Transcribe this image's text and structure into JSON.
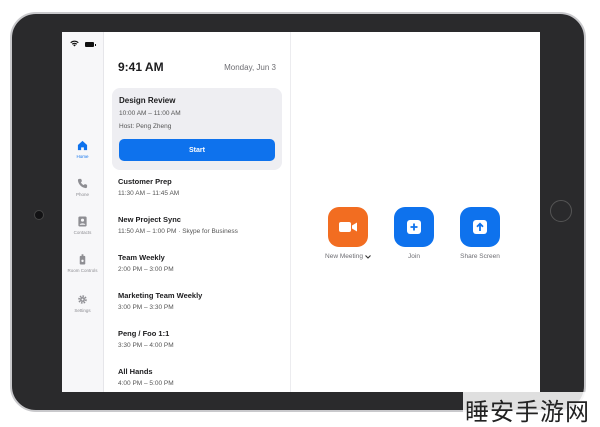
{
  "status_bar": {
    "wifi_icon": "wifi-icon",
    "battery_icon": "battery-icon"
  },
  "nav": {
    "items": [
      {
        "label": "Home",
        "icon": "home-icon",
        "active": true
      },
      {
        "label": "Phone",
        "icon": "phone-icon",
        "active": false
      },
      {
        "label": "Contacts",
        "icon": "contacts-icon",
        "active": false
      },
      {
        "label": "Room Controls",
        "icon": "room-controls-icon",
        "active": false
      },
      {
        "label": "Settings",
        "icon": "gear-icon",
        "active": false
      }
    ]
  },
  "header": {
    "time": "9:41 AM",
    "date": "Monday, Jun 3"
  },
  "current_meeting": {
    "title": "Design Review",
    "time": "10:00 AM – 11:00 AM",
    "host": "Host: Peng Zheng",
    "start_label": "Start"
  },
  "meetings": [
    {
      "title": "Customer Prep",
      "time": "11:30 AM – 11:45 AM"
    },
    {
      "title": "New Project Sync",
      "time": "11:50 AM – 1:00 PM  ·  Skype for Business"
    },
    {
      "title": "Team Weekly",
      "time": "2:00 PM – 3:00 PM"
    },
    {
      "title": "Marketing Team Weekly",
      "time": "3:00 PM – 3:30 PM"
    },
    {
      "title": "Peng / Foo 1:1",
      "time": "3:30 PM – 4:00 PM"
    },
    {
      "title": "All Hands",
      "time": "4:00 PM – 5:00 PM"
    }
  ],
  "actions": {
    "new_meeting": {
      "label": "New Meeting",
      "icon": "video-camera-icon",
      "color": "#f26d21"
    },
    "join": {
      "label": "Join",
      "icon": "plus-icon",
      "color": "#0e72ed"
    },
    "share_screen": {
      "label": "Share Screen",
      "icon": "upload-arrow-icon",
      "color": "#0e72ed"
    }
  },
  "colors": {
    "accent": "#0e72ed",
    "orange": "#f26d21"
  },
  "watermark": "睡安手游网"
}
